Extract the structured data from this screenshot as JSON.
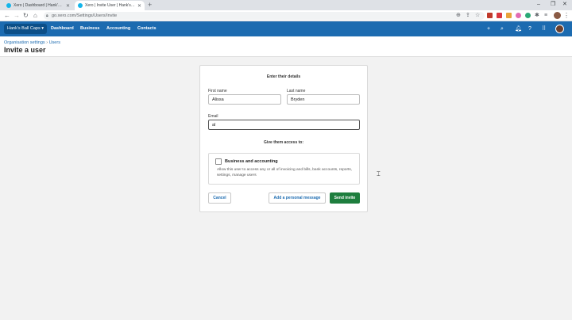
{
  "browser": {
    "tabs": [
      {
        "title": "Xero | Dashboard | Hank's Ball Ca",
        "active": false
      },
      {
        "title": "Xero | Invite User | Hank's Ball C",
        "active": true
      }
    ],
    "new_tab_glyph": "+",
    "url": "go.xero.com/Settings/Users/Invite"
  },
  "xero_nav": {
    "org_name": "Hank's Ball Caps",
    "org_caret": "▾",
    "links": [
      "Dashboard",
      "Business",
      "Accounting",
      "Contacts"
    ],
    "icons": [
      "plus-icon",
      "search-icon",
      "bell-icon",
      "help-icon",
      "apps-grid-icon"
    ]
  },
  "page": {
    "breadcrumb": {
      "parent": "Organisation settings",
      "separator": "›",
      "current": "Users"
    },
    "title": "Invite a user"
  },
  "form": {
    "details_heading": "Enter their details",
    "first_name": {
      "label": "First name",
      "value": "Alissa"
    },
    "last_name": {
      "label": "Last name",
      "value": "Bryden"
    },
    "email": {
      "label": "Email",
      "value": "al"
    },
    "access_heading": "Give them access to:",
    "access_option": {
      "title": "Business and accounting",
      "description": "Allow this user to access any or all of invoicing and bills, bank accounts, reports, settings, manage users",
      "checked": false
    },
    "buttons": {
      "cancel": "Cancel",
      "personal_message": "Add a personal message",
      "send": "Send invite"
    }
  },
  "colors": {
    "xero_blue": "#1c6bb0",
    "send_green": "#1e7e3e"
  }
}
